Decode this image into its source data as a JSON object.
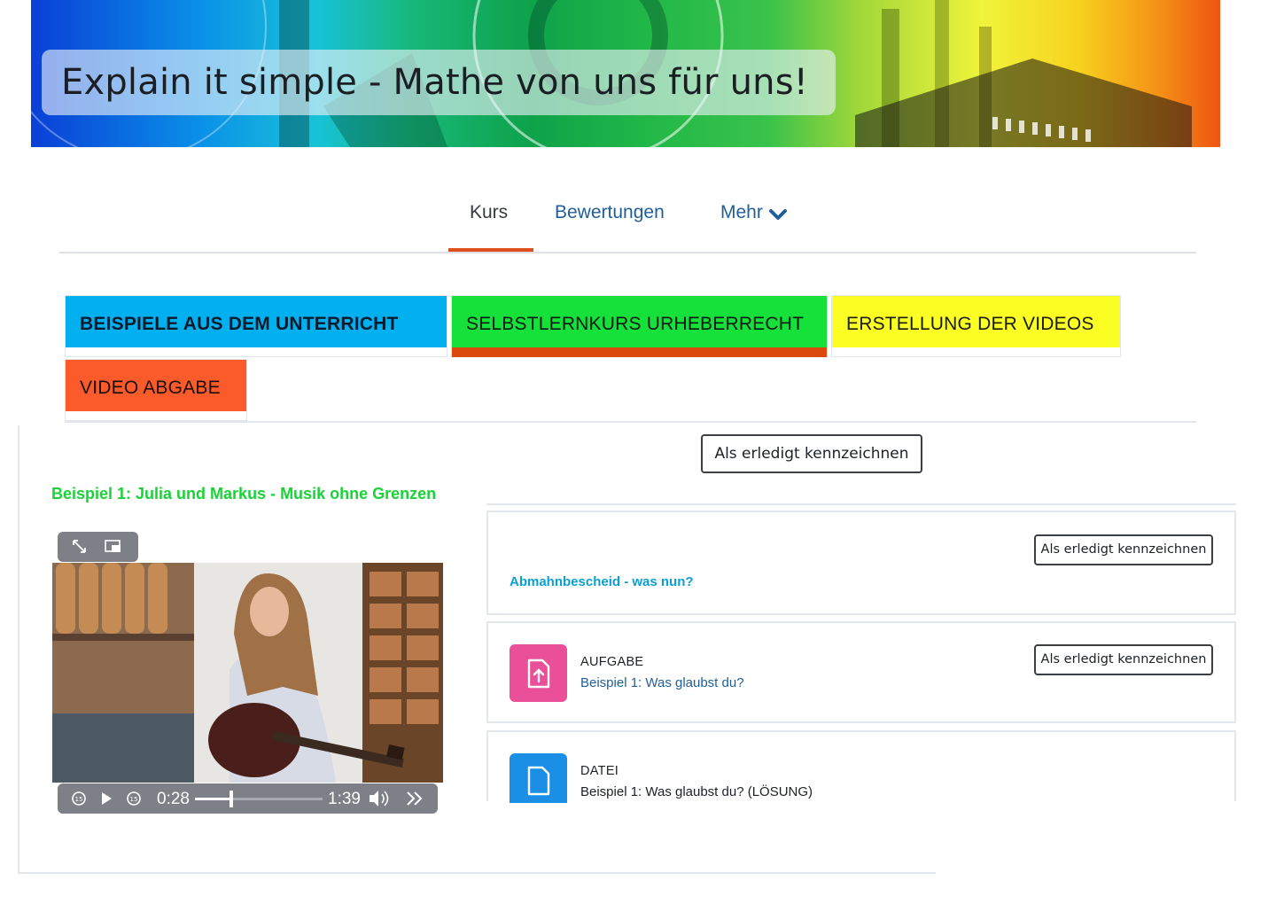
{
  "banner": {
    "title": "Explain it simple - Mathe von uns für uns!"
  },
  "nav": {
    "items": [
      {
        "label": "Kurs",
        "active": true
      },
      {
        "label": "Bewertungen",
        "active": false
      },
      {
        "label": "Mehr",
        "active": false
      }
    ]
  },
  "sections": {
    "tabs": [
      {
        "label": "BEISPIELE AUS DEM UNTERRICHT",
        "color": "#03b0ef"
      },
      {
        "label": "SELBSTLERNKURS URHEBERRECHT",
        "color": "#15e13a",
        "active": true
      },
      {
        "label": "ERSTELLUNG DER VIDEOS",
        "color": "#fbff23"
      },
      {
        "label": "VIDEO ABGABE",
        "color": "#fb5a2a"
      }
    ]
  },
  "content": {
    "mark_done_label": "Als erledigt kennzeichnen",
    "section_title": "Beispiel 1: Julia und Markus - Musik ohne Grenzen",
    "video": {
      "current_time": "0:28",
      "duration": "1:39",
      "progress": 0.283
    },
    "activities": [
      {
        "type": "",
        "name": "Abmahnbescheid - was nun?",
        "button": "Als erledigt kennzeichnen"
      },
      {
        "type": "AUFGABE",
        "name": "Beispiel 1: Was glaubst du?",
        "button": "Als erledigt kennzeichnen",
        "icon": "assignment-icon",
        "icon_color": "#ea4f9a"
      },
      {
        "type": "DATEI",
        "name": "Beispiel 1: Was glaubst du? (LÖSUNG)",
        "icon": "file-icon",
        "icon_color": "#1b8fe5"
      }
    ]
  },
  "colors": {
    "accent": "#e0501f",
    "link": "#215f9a",
    "section_link": "#19d238",
    "activity_link": "#0aa0d2"
  }
}
